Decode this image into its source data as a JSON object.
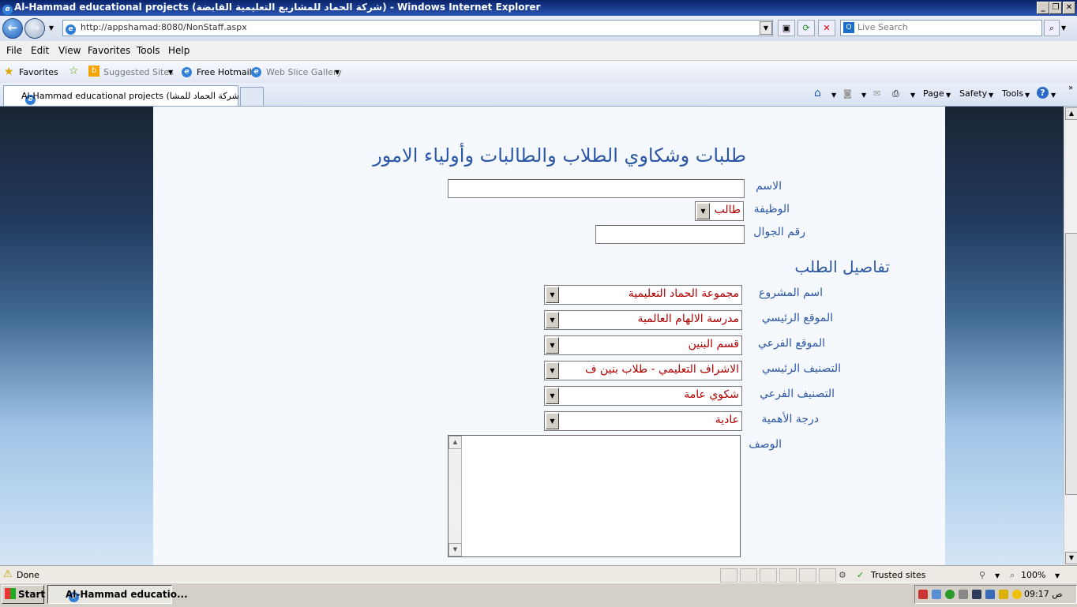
{
  "window": {
    "title": "Al-Hammad educational projects (شركة الحماد للمشاريع التعليمية القابضة) - Windows Internet Explorer"
  },
  "address": {
    "url": "http://appshamad:8080/NonStaff.aspx"
  },
  "search": {
    "placeholder": "Live Search"
  },
  "menu": [
    "File",
    "Edit",
    "View",
    "Favorites",
    "Tools",
    "Help"
  ],
  "favorites": {
    "label": "Favorites",
    "items": [
      "Suggested Sites",
      "Free Hotmail",
      "Web Slice Gallery"
    ]
  },
  "tab": {
    "label": "Al-Hammad educational projects (شركة الحماد للمشا..."
  },
  "commandbar": {
    "page": "Page",
    "safety": "Safety",
    "tools": "Tools"
  },
  "form": {
    "title": "طلبات وشكاوي الطلاب والطالبات وأولياء الامور",
    "name_label": "الاسم",
    "name_value": "",
    "role_label": "الوظيفة",
    "role_value": "طالب",
    "mobile_label": "رقم الجوال",
    "mobile_value": "",
    "details_title": "تفاصيل الطلب",
    "project_label": "اسم المشروع",
    "project_value": "مجموعة الحماد التعليمية",
    "main_location_label": "الموقع الرئيسي",
    "main_location_value": "مدرسة الالهام العالمية",
    "sub_location_label": "الموقع الفرعي",
    "sub_location_value": "قسم البنين",
    "main_category_label": "التصنيف الرئيسي",
    "main_category_value": "الاشراف التعليمي - طلاب بنين ف",
    "sub_category_label": "التصنيف الفرعي",
    "sub_category_value": "شكوي عامة",
    "priority_label": "درجة الأهمية",
    "priority_value": "عادية",
    "description_label": "الوصف",
    "description_value": ""
  },
  "status": {
    "text": "Done",
    "zone": "Trusted sites",
    "zoom": "100%"
  },
  "taskbar": {
    "start": "Start",
    "item": "Al-Hammad educatio...",
    "clock": "09:17 ص"
  }
}
